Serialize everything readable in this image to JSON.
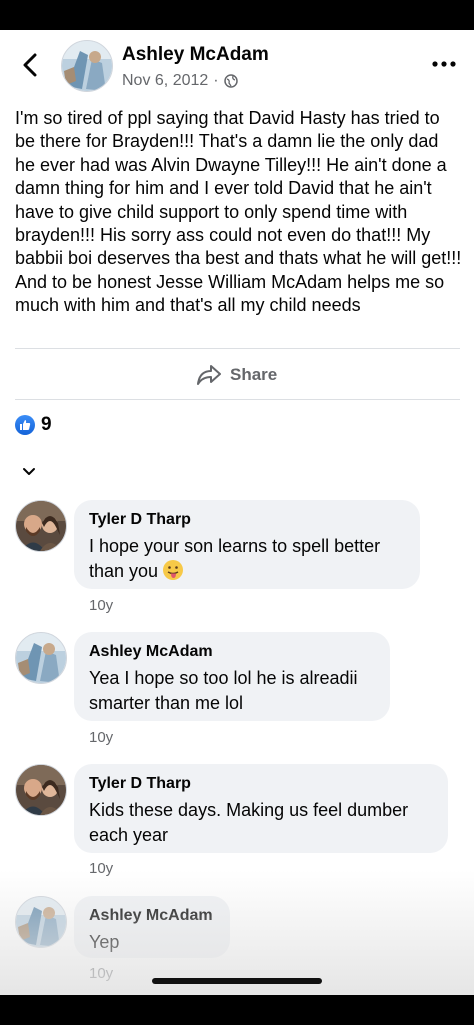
{
  "post": {
    "author": "Ashley McAdam",
    "date": "Nov 6, 2012",
    "separator": "·",
    "text": "I'm so tired of ppl saying that David Hasty has tried to be there for Brayden!!! That's a damn lie the only dad he ever had was Alvin Dwayne Tilley!!! He ain't done a damn thing for him and I ever told David that he ain't have to give child support to only spend time with brayden!!! His sorry ass could not even do that!!! My babbii boi deserves tha best and thats what he will get!!! And to be honest Jesse William McAdam helps me so much with him and that's all my child needs"
  },
  "actions": {
    "share_label": "Share"
  },
  "reactions": {
    "count": "9",
    "icon": "like-icon"
  },
  "comments": [
    {
      "author": "Tyler D Tharp",
      "text": "I hope your son learns to spell better than you",
      "emoji": "tongue-out-emoji",
      "time": "10y"
    },
    {
      "author": "Ashley McAdam",
      "text": "Yea I hope so too lol he is alreadii smarter than me lol",
      "time": "10y"
    },
    {
      "author": "Tyler D Tharp",
      "text": "Kids these days. Making us feel dumber each year",
      "time": "10y"
    },
    {
      "author": "Ashley McAdam",
      "text": "Yep",
      "time": "10y"
    }
  ],
  "colors": {
    "secondary_text": "#65676b",
    "bubble": "#f0f2f5",
    "like_blue": "#1877f2"
  }
}
